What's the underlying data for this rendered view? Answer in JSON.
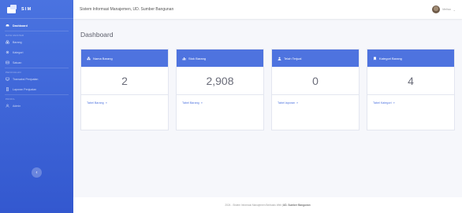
{
  "brand": {
    "name": "SIM"
  },
  "topbar": {
    "title": "Sistem Informasi Manajemen, UD. Sumber Bangunan",
    "user_name": "Melisa"
  },
  "sidebar": {
    "dashboard": "Dashboard",
    "section_master": "DATA MASTER",
    "barang": "Barang",
    "kategori": "Kategori",
    "satuan": "Satuan",
    "section_penjualan": "PENJUALAN",
    "transaksi": "Transaksi Penjualan",
    "laporan": "Laporan Penjualan",
    "section_profil": "PROFIL",
    "admin": "Admin",
    "toggle_icon": "chevron-left-icon"
  },
  "page": {
    "title": "Dashboard"
  },
  "cards": [
    {
      "title": "Nama Barang",
      "icon": "boxes-icon",
      "value": "2",
      "link": "Tabel Barang"
    },
    {
      "title": "Stok Barang",
      "icon": "bar-chart-icon",
      "value": "2,908",
      "link": "Tabel Barang"
    },
    {
      "title": "Telah Terjual",
      "icon": "user-icon",
      "value": "0",
      "link": "Tabel laporan"
    },
    {
      "title": "Kategori Barang",
      "icon": "bookmark-icon",
      "value": "4",
      "link": "Tabel Kategori"
    }
  ],
  "footer": {
    "text": "2024 - Sistem Informasi Manajemen Berbasis Web | ",
    "brand": "UD. Sumber Bangunan"
  },
  "colors": {
    "sidebar": "#4a73e0",
    "card_header": "#4e73df",
    "link": "#4e73df"
  }
}
